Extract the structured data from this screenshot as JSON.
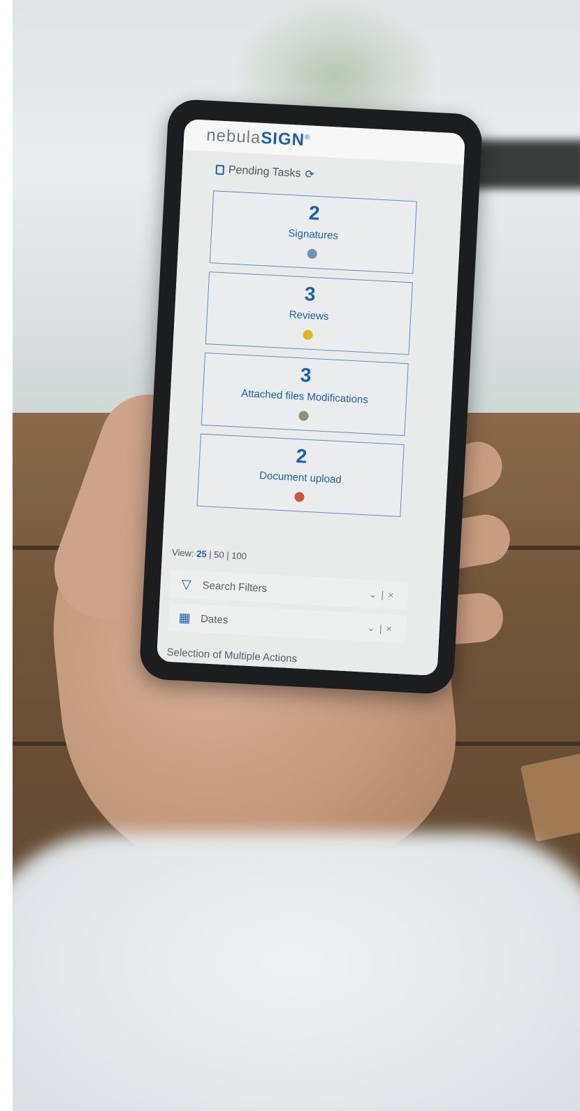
{
  "brand": {
    "logo_main": "nebula",
    "logo_accent": "SIGN",
    "logo_mark": "®"
  },
  "header": {
    "title": "Pending Tasks",
    "refresh_icon": "refresh-icon"
  },
  "tasks": [
    {
      "count": "2",
      "label": "Signatures",
      "color": "#6e93b8"
    },
    {
      "count": "3",
      "label": "Reviews",
      "color": "#e3b21c"
    },
    {
      "count": "3",
      "label": "Attached files Modifications",
      "color": "#7f9b6f"
    },
    {
      "count": "2",
      "label": "Document upload",
      "color": "#cc5647"
    }
  ],
  "view": {
    "label": "View:",
    "options": [
      "25",
      "50",
      "100"
    ],
    "selected": "25"
  },
  "filters": [
    {
      "label": "Search Filters",
      "icon": "filter-icon"
    },
    {
      "label": "Dates",
      "icon": "calendar-icon"
    }
  ],
  "partial_row": {
    "label": "Selection of Multiple Actions"
  }
}
